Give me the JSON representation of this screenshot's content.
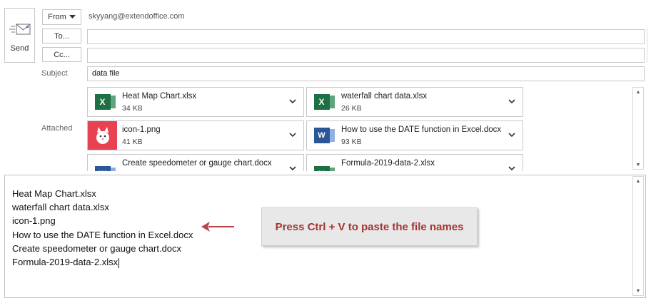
{
  "header": {
    "send_label": "Send",
    "from_label": "From",
    "from_address": "skyyang@extendoffice.com",
    "to_label": "To...",
    "to_value": "",
    "cc_label": "Cc...",
    "cc_value": "",
    "subject_label": "Subject",
    "subject_value": "data file",
    "attached_label": "Attached"
  },
  "attachments": [
    {
      "name": "Heat Map Chart.xlsx",
      "size": "34 KB",
      "icon": "excel-icon"
    },
    {
      "name": "waterfall chart data.xlsx",
      "size": "26 KB",
      "icon": "excel-icon"
    },
    {
      "name": "icon-1.png",
      "size": "41 KB",
      "icon": "image-icon"
    },
    {
      "name": "How to use the DATE function in Excel.docx",
      "size": "93 KB",
      "icon": "word-icon"
    },
    {
      "name": "Create speedometer or gauge chart.docx",
      "size": "",
      "icon": "word-icon"
    },
    {
      "name": "Formula-2019-data-2.xlsx",
      "size": "",
      "icon": "excel-icon"
    }
  ],
  "body": {
    "lines": [
      "Heat Map Chart.xlsx",
      "waterfall chart data.xlsx",
      "icon-1.png",
      "How to use the DATE function in Excel.docx",
      "Create speedometer or gauge chart.docx",
      "Formula-2019-data-2.xlsx"
    ]
  },
  "callout": {
    "text": "Press Ctrl + V to paste the file names",
    "color": "#a3342f"
  },
  "icons": {
    "excel_glyph": "X",
    "word_glyph": "W"
  }
}
